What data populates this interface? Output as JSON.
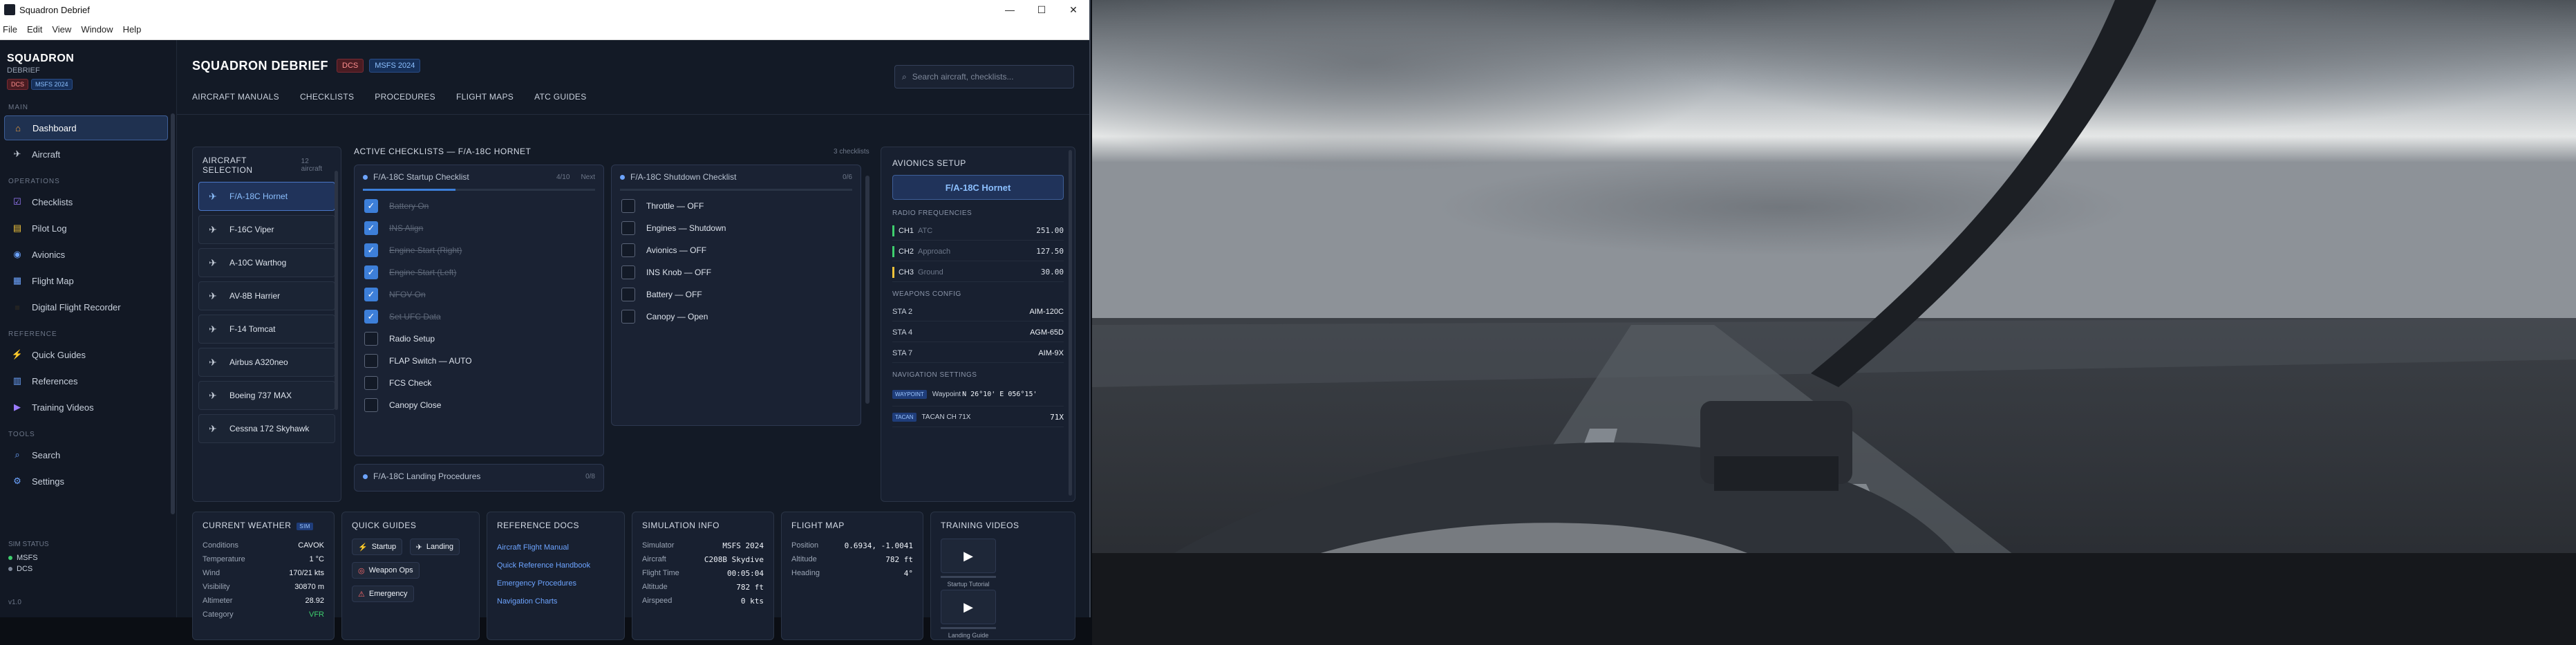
{
  "window": {
    "title": "Squadron Debrief",
    "minimize": "—",
    "maximize": "☐",
    "close": "✕"
  },
  "menu": [
    "File",
    "Edit",
    "View",
    "Window",
    "Help"
  ],
  "sidebar": {
    "brand": "SQUADRON",
    "subtitle": "DEBRIEF",
    "tags": [
      "DCS",
      "MSFS 2024"
    ],
    "sections": {
      "main": "MAIN",
      "operations": "OPERATIONS",
      "reference": "REFERENCE",
      "tools": "TOOLS",
      "sim_status": "SIM STATUS"
    },
    "items": {
      "dashboard": "Dashboard",
      "aircraft": "Aircraft",
      "checklists": "Checklists",
      "pilot_log": "Pilot Log",
      "avionics": "Avionics",
      "flight_map": "Flight Map",
      "dfr": "Digital Flight Recorder",
      "quick_guides": "Quick Guides",
      "references": "References",
      "training_videos": "Training Videos",
      "search": "Search",
      "settings": "Settings"
    },
    "sim_status": [
      {
        "name": "MSFS",
        "color": "#3ecf6e"
      },
      {
        "name": "DCS",
        "color": "#7d8799"
      }
    ],
    "version": "v1.0"
  },
  "header": {
    "title": "SQUADRON DEBRIEF",
    "tags": [
      "DCS",
      "MSFS 2024"
    ],
    "search_placeholder": "Search aircraft, checklists..."
  },
  "tabs": [
    "AIRCRAFT MANUALS",
    "CHECKLISTS",
    "PROCEDURES",
    "FLIGHT MAPS",
    "ATC GUIDES"
  ],
  "aircraft_selection": {
    "title": "AIRCRAFT SELECTION",
    "count": "12 aircraft",
    "items": [
      "F/A-18C Hornet",
      "F-16C Viper",
      "A-10C Warthog",
      "AV-8B Harrier",
      "F-14 Tomcat",
      "Airbus A320neo",
      "Boeing 737 MAX",
      "Cessna 172 Skyhawk"
    ]
  },
  "active_checklists": {
    "title": "ACTIVE CHECKLISTS — F/A-18C HORNET",
    "count": "3 checklists",
    "startup": {
      "title": "F/A-18C Startup Checklist",
      "count": "4/10",
      "status": "Next",
      "progress": 0.4,
      "items": [
        {
          "label": "Battery On",
          "done": true
        },
        {
          "label": "INS Align",
          "done": true
        },
        {
          "label": "Engine Start (Right)",
          "done": true
        },
        {
          "label": "Engine Start (Left)",
          "done": true
        },
        {
          "label": "NFOV On",
          "done": true
        },
        {
          "label": "Set UFC Data",
          "done": true
        },
        {
          "label": "Radio Setup",
          "done": false
        },
        {
          "label": "FLAP Switch — AUTO",
          "done": false
        },
        {
          "label": "FCS Check",
          "done": false
        },
        {
          "label": "Canopy Close",
          "done": false
        }
      ]
    },
    "shutdown": {
      "title": "F/A-18C Shutdown Checklist",
      "count": "0/6",
      "items": [
        {
          "label": "Throttle — OFF",
          "done": false
        },
        {
          "label": "Engines — Shutdown",
          "done": false
        },
        {
          "label": "Avionics — OFF",
          "done": false
        },
        {
          "label": "INS Knob — OFF",
          "done": false
        },
        {
          "label": "Battery — OFF",
          "done": false
        },
        {
          "label": "Canopy — Open",
          "done": false
        }
      ]
    },
    "landing": {
      "title": "F/A-18C Landing Procedures",
      "count": "0/8"
    }
  },
  "avionics": {
    "title": "AVIONICS SETUP",
    "aircraft": "F/A-18C Hornet",
    "radio_title": "RADIO FREQUENCIES",
    "radios": [
      {
        "ch": "CH1",
        "name": "ATC",
        "freq": "251.00",
        "color": "#3ecf6e"
      },
      {
        "ch": "CH2",
        "name": "Approach",
        "freq": "127.50",
        "color": "#3ecf6e"
      },
      {
        "ch": "CH3",
        "name": "Ground",
        "freq": "30.00",
        "color": "#f0c23a"
      }
    ],
    "weapons_title": "WEAPONS CONFIG",
    "weapons": [
      {
        "sta": "STA 2",
        "load": "AIM-120C"
      },
      {
        "sta": "STA 4",
        "load": "AGM-65D"
      },
      {
        "sta": "STA 7",
        "load": "AIM-9X"
      }
    ],
    "nav_title": "NAVIGATION SETTINGS",
    "nav": [
      {
        "tag": "WAYPOINT",
        "label": "Waypoint",
        "value": "N 26°10' E 056°15'"
      },
      {
        "tag": "TACAN",
        "label": "TACAN CH 71X",
        "value": "71X"
      }
    ]
  },
  "weather": {
    "title": "CURRENT WEATHER",
    "badge": "SIM",
    "rows": [
      {
        "k": "Conditions",
        "v": "CAVOK"
      },
      {
        "k": "Temperature",
        "v": "1 °C"
      },
      {
        "k": "Wind",
        "v": "170/21 kts"
      },
      {
        "k": "Visibility",
        "v": "30870 m"
      },
      {
        "k": "Altimeter",
        "v": "28.92"
      },
      {
        "k": "Category",
        "v": "VFR"
      }
    ]
  },
  "quick_guides": {
    "title": "QUICK GUIDES",
    "items": [
      "Startup",
      "Landing",
      "Weapon Ops",
      "Emergency"
    ]
  },
  "reference_docs": {
    "title": "REFERENCE DOCS",
    "items": [
      "Aircraft Flight Manual",
      "Quick Reference Handbook",
      "Emergency Procedures",
      "Navigation Charts"
    ]
  },
  "simulation_info": {
    "title": "SIMULATION INFO",
    "rows": [
      {
        "k": "Simulator",
        "v": "MSFS 2024"
      },
      {
        "k": "Aircraft",
        "v": "C208B Skydive"
      },
      {
        "k": "Flight Time",
        "v": "00:05:04"
      },
      {
        "k": "Altitude",
        "v": "782 ft"
      },
      {
        "k": "Airspeed",
        "v": "0 kts"
      }
    ]
  },
  "flight_map": {
    "title": "FLIGHT MAP",
    "rows": [
      {
        "k": "Position",
        "v": "0.6934, -1.0041"
      },
      {
        "k": "Altitude",
        "v": "782 ft"
      },
      {
        "k": "Heading",
        "v": "4°"
      }
    ]
  },
  "training_videos": {
    "title": "TRAINING VIDEOS",
    "items": [
      "Startup Tutorial",
      "Landing Guide"
    ]
  },
  "colors": {
    "accent": "#3d7fd9",
    "bg": "#131a26",
    "panel": "#182030"
  }
}
